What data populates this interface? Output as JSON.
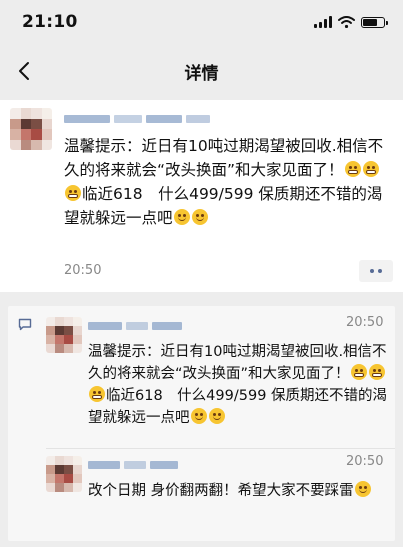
{
  "status_bar": {
    "time": "21:10"
  },
  "nav": {
    "title": "详情"
  },
  "post": {
    "text_1": "温馨提示：近日有10吨过期渴望被回收.相信不久的将来就会“改头换面”和大家见面了！",
    "text_2": "临近618　什么499/599  保质期还不错的渴望就躲远一点吧",
    "time": "20:50"
  },
  "comments": [
    {
      "text_1": "温馨提示：近日有10吨过期渴望被回收.相信不久的将来就会“改头换面”和大家见面了！",
      "text_2": "临近618　什么499/599  保质期还不错的渴望就躲远一点吧",
      "time": "20:50"
    },
    {
      "text_1": "改个日期 身价翻两翻！希望大家不要踩雷",
      "time": "20:50"
    }
  ],
  "icons": {
    "back": "back-arrow-icon",
    "more": "more-dots-icon",
    "comment": "comment-bubble-icon",
    "emoji_grin": "grin-emoji-icon",
    "emoji_smile": "smile-emoji-icon"
  },
  "colors": {
    "link": "#576b95",
    "background": "#ededed",
    "card": "#ffffff",
    "comment_panel": "#f7f7f7"
  }
}
